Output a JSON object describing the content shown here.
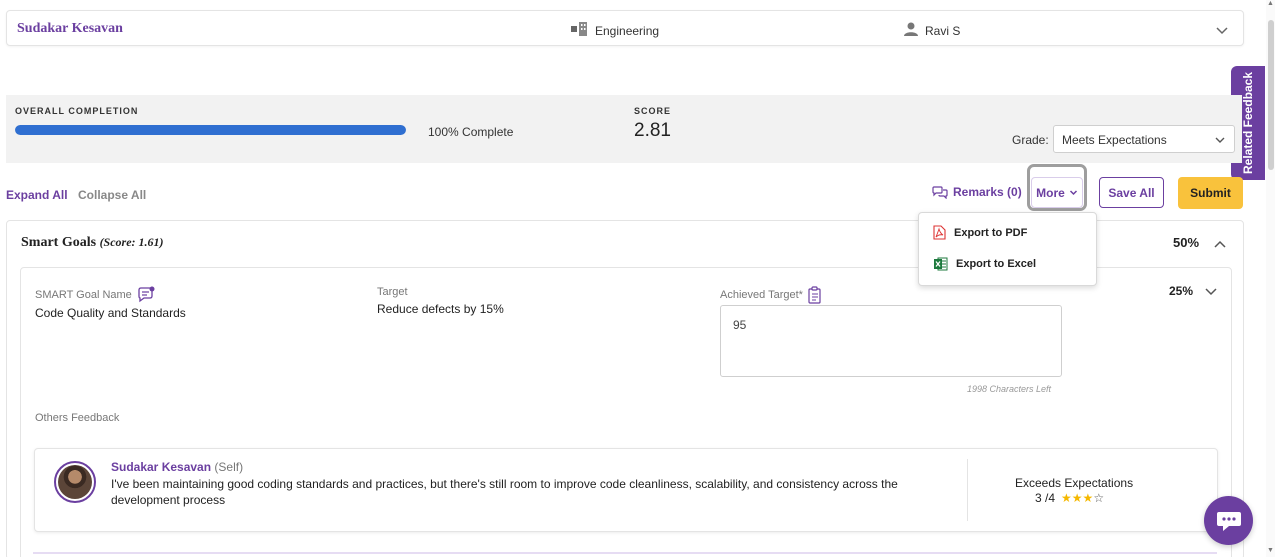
{
  "header": {
    "employee_name": "Sudakar Kesavan",
    "department": "Engineering",
    "manager": "Ravi S"
  },
  "completion": {
    "label": "OVERALL COMPLETION",
    "progress_fraction": 1.0,
    "progress_text": "100% Complete",
    "score_label": "SCORE",
    "score_value": "2.81",
    "grade_label": "Grade:",
    "grade_value": "Meets Expectations"
  },
  "toolbar": {
    "expand_all": "Expand All",
    "collapse_all": "Collapse All",
    "remarks": "Remarks (0)",
    "more": "More",
    "save_all": "Save All",
    "submit": "Submit"
  },
  "related_feedback_tab": "Related Feedback",
  "dropdown": {
    "export_pdf": "Export to PDF",
    "export_excel": "Export to Excel"
  },
  "section": {
    "title": "Smart Goals",
    "score": "(Score: 1.61)",
    "weight": "50%"
  },
  "goal": {
    "name_label": "SMART Goal Name",
    "name_value": "Code Quality and Standards",
    "target_label": "Target",
    "target_value": "Reduce defects by 15%",
    "achieved_label": "Achieved Target*",
    "achieved_value": "95",
    "chars_left": "1998 Characters Left",
    "weight": "25%",
    "others_feedback_label": "Others Feedback"
  },
  "feedback": {
    "name": "Sudakar Kesavan",
    "role": "(Self)",
    "text": "I've been maintaining good coding standards and practices, but there's still room to improve code cleanliness, scalability, and consistency across the development process",
    "rating_label": "Exceeds Expectations",
    "rating_value": "3 /4",
    "stars_filled": 3,
    "stars_total": 4
  },
  "colors": {
    "brand_purple": "#6b3fa0",
    "progress_blue": "#2f6fd1",
    "submit_yellow": "#f9c23c",
    "star_gold": "#f5b800"
  }
}
